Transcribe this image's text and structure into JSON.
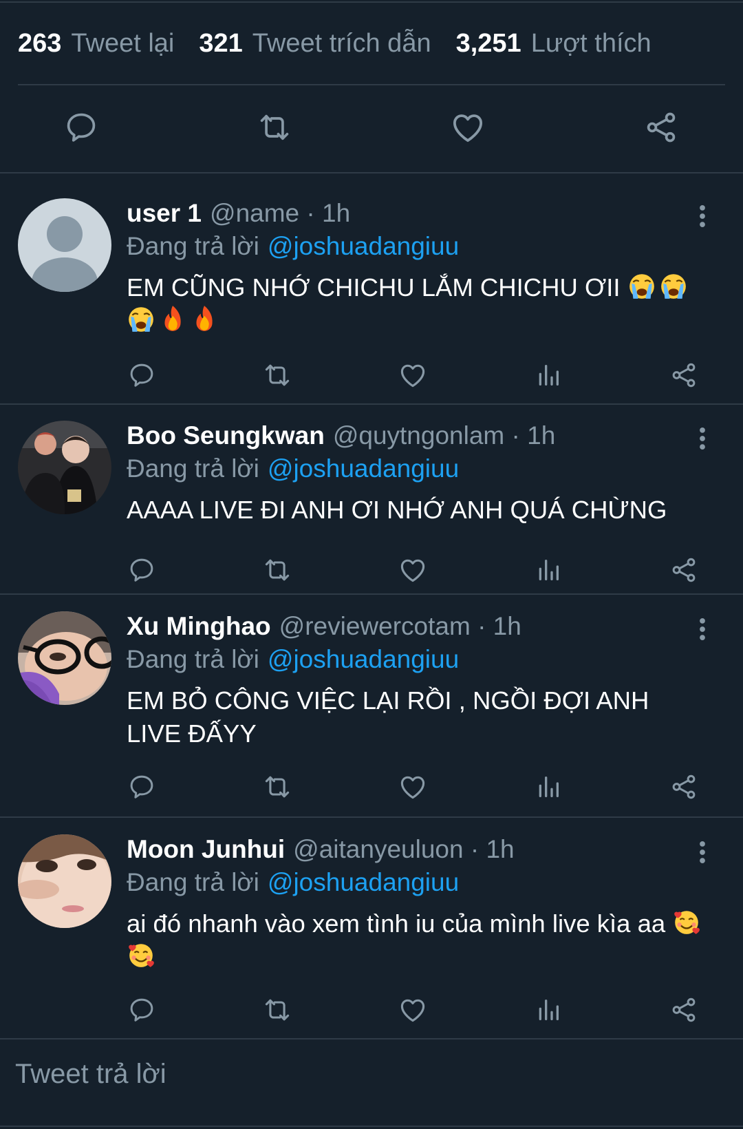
{
  "stats": {
    "retweets_count": "263",
    "retweets_label": "Tweet lại",
    "quotes_count": "321",
    "quotes_label": "Tweet trích dẫn",
    "likes_count": "3,251",
    "likes_label": "Lượt thích"
  },
  "replies": [
    {
      "name": "user 1",
      "handle": "@name · 1h",
      "reply_to_label": "Đang trả lời",
      "mention": "@joshuadangiuu",
      "text": "EM CŨNG NHỚ CHICHU LẮM CHICHU ƠII",
      "emojis": [
        "loudly-crying-face",
        "loudly-crying-face",
        "loudly-crying-face",
        "fire",
        "fire"
      ]
    },
    {
      "name": "Boo Seungkwan",
      "handle": "@quytngonlam · 1h",
      "reply_to_label": "Đang trả lời",
      "mention": "@joshuadangiuu",
      "text": "AAAA LIVE ĐI ANH ƠI NHỚ ANH QUÁ CHỪNG"
    },
    {
      "name": "Xu Minghao",
      "handle": "@reviewercotam · 1h",
      "reply_to_label": "Đang trả lời",
      "mention": "@joshuadangiuu",
      "text": "EM BỎ CÔNG VIỆC LẠI RỒI , NGỒI ĐỢI ANH LIVE ĐẤYY"
    },
    {
      "name": "Moon Junhui",
      "handle": "@aitanyeuluon · 1h",
      "reply_to_label": "Đang trả lời",
      "mention": "@joshuadangiuu",
      "text": "ai đó nhanh vào xem tình iu của mình live kìa aa",
      "emojis": [
        "smiling-face-with-hearts",
        "smiling-face-with-hearts"
      ]
    }
  ],
  "compose": {
    "placeholder": "Tweet trả lời"
  },
  "icons": {
    "reply": "reply-icon",
    "retweet": "retweet-icon",
    "like": "heart-icon",
    "analytics": "analytics-icon",
    "share": "share-icon",
    "more": "more-vertical-icon"
  },
  "colors": {
    "background": "#15202b",
    "divider": "#2f3b47",
    "secondary_text": "#8899a6",
    "mention": "#1da1f2",
    "primary_text": "#ffffff"
  }
}
